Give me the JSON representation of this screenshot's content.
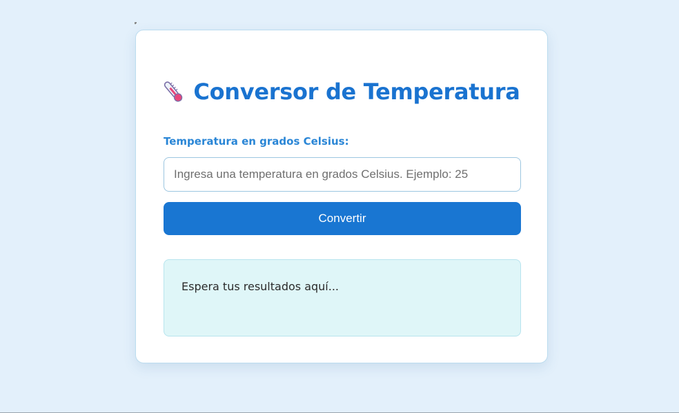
{
  "converter": {
    "title": "Conversor de Temperatura",
    "title_icon": "thermometer-icon",
    "input_label": "Temperatura en grados Celsius:",
    "input_value": "",
    "input_placeholder": "Ingresa una temperatura en grados Celsius. Ejemplo: 25",
    "button_label": "Convertir",
    "result_text": "Espera tus resultados aquí..."
  },
  "colors": {
    "background": "#e3f0fb",
    "accent": "#1976d2",
    "title": "#1a73d0",
    "result_background": "#dff6f8"
  }
}
